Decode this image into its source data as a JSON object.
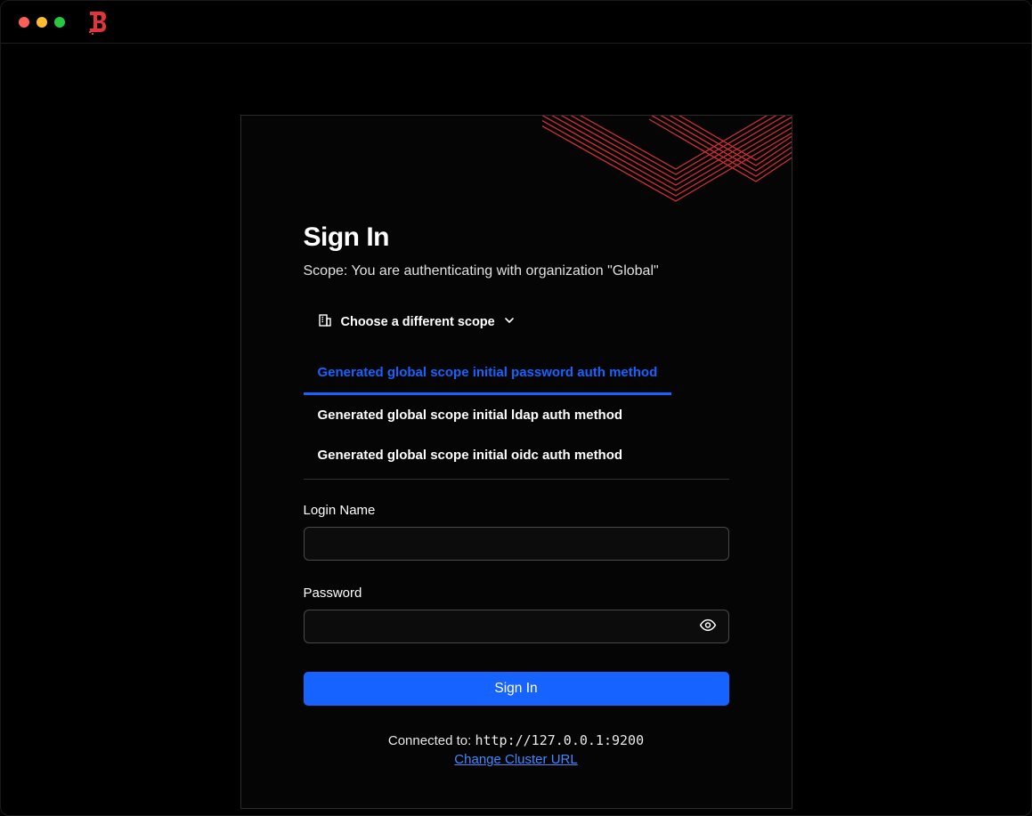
{
  "header": {
    "brand": "Boundary"
  },
  "signin": {
    "title": "Sign In",
    "scope_text": "Scope: You are authenticating with organization \"Global\"",
    "choose_scope_label": "Choose a different scope",
    "auth_methods": [
      {
        "label": "Generated global scope initial password auth method",
        "active": true
      },
      {
        "label": "Generated global scope initial ldap auth method",
        "active": false
      },
      {
        "label": "Generated global scope initial oidc auth method",
        "active": false
      }
    ],
    "login_label": "Login Name",
    "login_value": "",
    "password_label": "Password",
    "password_value": "",
    "submit_label": "Sign In"
  },
  "footer": {
    "connected_label": "Connected to: ",
    "connected_url": "http://127.0.0.1:9200",
    "change_url_label": "Change Cluster URL"
  },
  "colors": {
    "accent": "#1763ff",
    "brand": "#e4333a"
  }
}
